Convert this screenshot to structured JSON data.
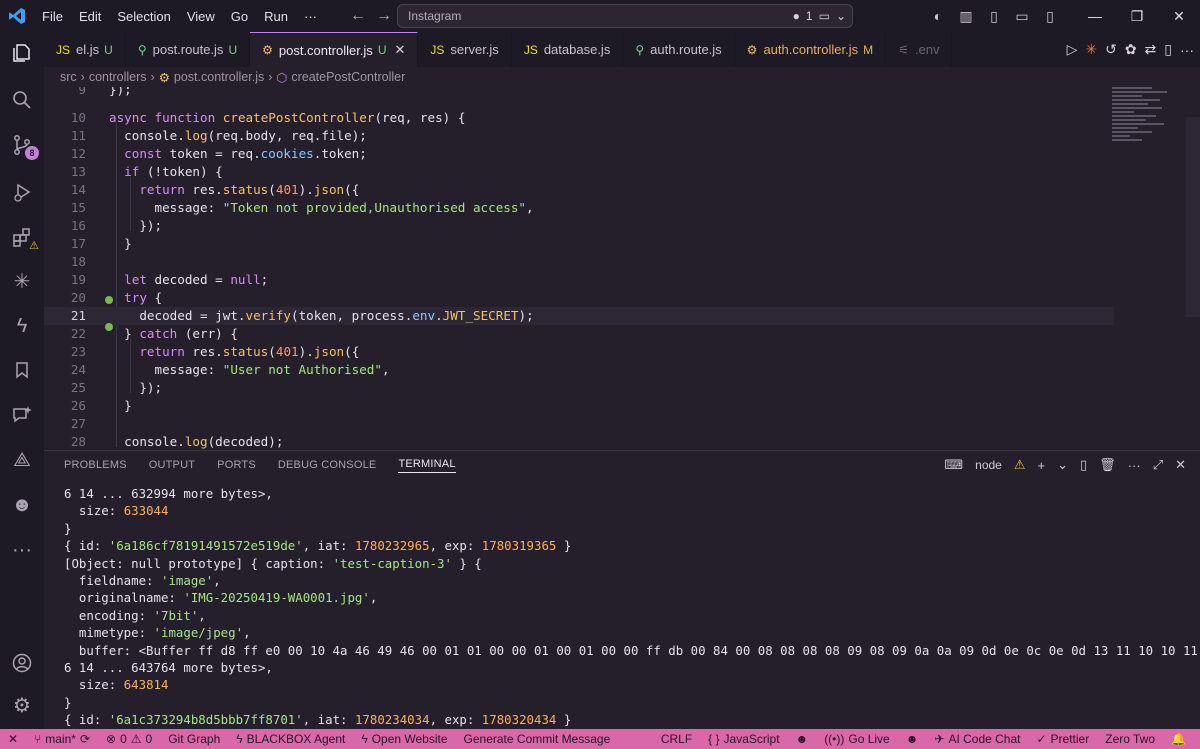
{
  "titlebar": {
    "menus": [
      "File",
      "Edit",
      "Selection",
      "View",
      "Go",
      "Run",
      "···"
    ],
    "search_text": "Instagram",
    "changes_count": "1"
  },
  "activity": {
    "source_control_badge": "8"
  },
  "tabs": [
    {
      "label": "el.js",
      "status": "U",
      "icon": "js-icon",
      "icon_color": "#f5de19"
    },
    {
      "label": "post.route.js",
      "status": "U",
      "icon": "route-icon",
      "icon_color": "#7fcf8e"
    },
    {
      "label": "post.controller.js",
      "status": "U",
      "icon": "gear-icon",
      "icon_color": "#f3c26b",
      "active": true
    },
    {
      "label": "server.js",
      "status": "",
      "icon": "js-icon",
      "icon_color": "#f5de19"
    },
    {
      "label": "database.js",
      "status": "",
      "icon": "js-icon",
      "icon_color": "#f5de19"
    },
    {
      "label": "auth.route.js",
      "status": "",
      "icon": "route-icon",
      "icon_color": "#7fcf8e"
    },
    {
      "label": "auth.controller.js",
      "status": "M",
      "icon": "gear-icon",
      "icon_color": "#f3c26b"
    },
    {
      "label": ".env",
      "status": "",
      "icon": "settings-icon",
      "icon_color": "#6b6573"
    }
  ],
  "breadcrumb": [
    "src",
    "controllers",
    "post.controller.js",
    "createPostController"
  ],
  "editor": {
    "line_numbers": [
      "9",
      "10",
      "11",
      "12",
      "13",
      "14",
      "15",
      "16",
      "17",
      "18",
      "19",
      "20",
      "21",
      "22",
      "23",
      "24",
      "25",
      "26",
      "27",
      "28"
    ],
    "current_line": "21"
  },
  "panel": {
    "tabs": [
      "PROBLEMS",
      "OUTPUT",
      "PORTS",
      "DEBUG CONSOLE",
      "TERMINAL"
    ],
    "active_tab": "TERMINAL",
    "terminal_name": "node",
    "terminal_lines": [
      "6 14 ... 632994 more bytes>,",
      "  size: 633044",
      "}",
      "{ id: '6a186cf78191491572e519de', iat: 1780232965, exp: 1780319365 }",
      "[Object: null prototype] { caption: 'test-caption-3' } {",
      "  fieldname: 'image',",
      "  originalname: 'IMG-20250419-WA0001.jpg',",
      "  encoding: '7bit',",
      "  mimetype: 'image/jpeg',",
      "  buffer: <Buffer ff d8 ff e0 00 10 4a 46 49 46 00 01 01 00 00 01 00 01 00 00 ff db 00 84 00 08 08 08 08 09 08 09 0a 0a 09 0d 0e 0c 0e 0d 13 11 10 10 11 13 1c 14 1",
      "6 14 ... 643764 more bytes>,",
      "  size: 643814",
      "}",
      "{ id: '6a1c373294b8d5bbb7ff8701', iat: 1780234034, exp: 1780320434 }"
    ]
  },
  "statusbar": {
    "branch": "main*",
    "errors": "0",
    "warnings": "0",
    "git_graph": "Git Graph",
    "blackbox": "BLACKBOX Agent",
    "open_website": "Open Website",
    "commit_msg": "Generate Commit Message",
    "eol": "CRLF",
    "language": "JavaScript",
    "go_live": "Go Live",
    "ai_chat": "AI Code Chat",
    "prettier": "Prettier",
    "theme": "Zero Two",
    "accent_color": "#d868a8"
  }
}
